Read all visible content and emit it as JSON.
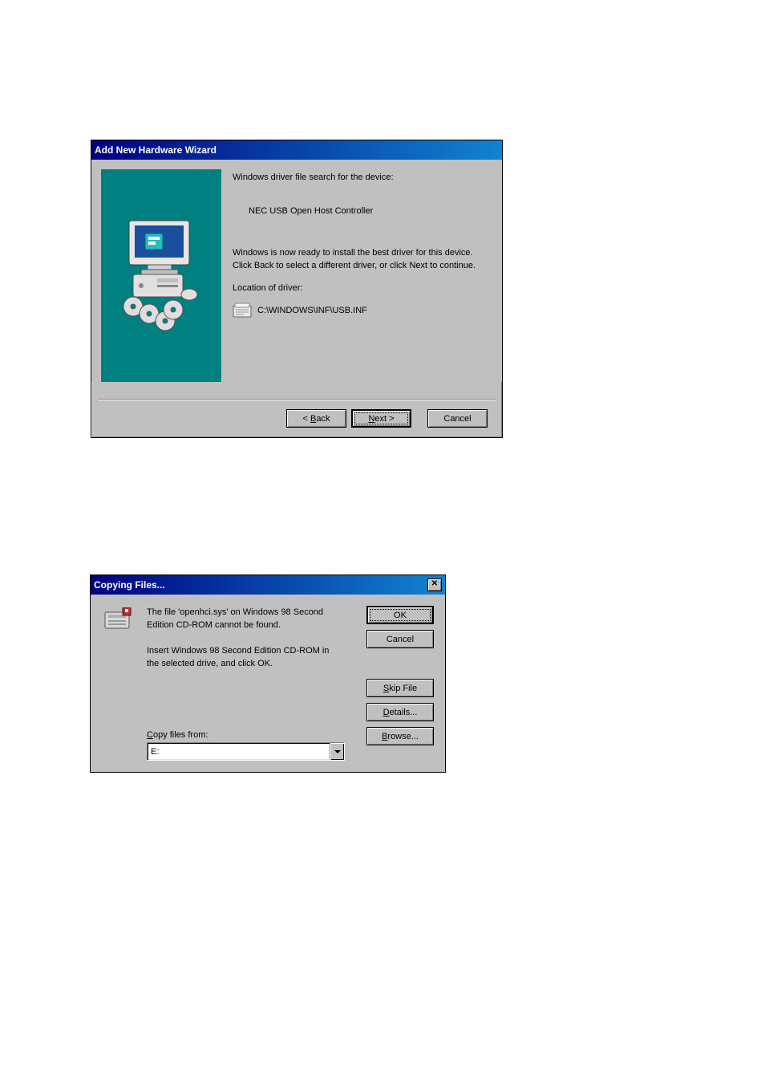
{
  "wizard": {
    "title": "Add New Hardware Wizard",
    "heading": "Windows driver file search for the device:",
    "device_name": "NEC USB Open Host Controller",
    "ready_msg": "Windows is now ready to install the best driver for this device. Click Back to select a different driver, or click Next to continue.",
    "location_label": "Location of driver:",
    "driver_path": "C:\\WINDOWS\\INF\\USB.INF",
    "buttons": {
      "back": "< Back",
      "next": "Next >",
      "cancel": "Cancel"
    }
  },
  "copying": {
    "title": "Copying Files...",
    "msg1": "The file 'openhci.sys' on Windows 98 Second Edition CD-ROM cannot be found.",
    "msg2": "Insert Windows 98 Second Edition CD-ROM in the selected drive, and click OK.",
    "copy_from_label": "Copy files from:",
    "copy_from_value": "E:",
    "buttons": {
      "ok": "OK",
      "cancel": "Cancel",
      "skip": "Skip File",
      "details": "Details...",
      "browse": "Browse..."
    }
  }
}
